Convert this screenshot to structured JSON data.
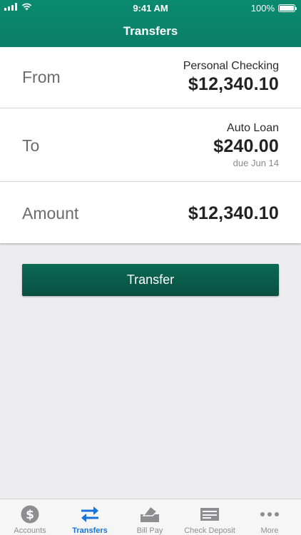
{
  "status": {
    "time": "9:41 AM",
    "battery": "100%",
    "battery_level": 1.0
  },
  "header": {
    "title": "Transfers"
  },
  "from": {
    "label": "From",
    "account": "Personal Checking",
    "amount": "$12,340.10"
  },
  "to": {
    "label": "To",
    "account": "Auto Loan",
    "amount": "$240.00",
    "due": "due Jun 14"
  },
  "amount_row": {
    "label": "Amount",
    "value": "$12,340.10"
  },
  "transfer_button": {
    "label": "Transfer"
  },
  "tabs": [
    {
      "label": "Accounts",
      "icon": "dollar-circle-icon"
    },
    {
      "label": "Transfers",
      "icon": "transfer-arrows-icon",
      "active": true
    },
    {
      "label": "Bill Pay",
      "icon": "bill-envelope-icon"
    },
    {
      "label": "Check Deposit",
      "icon": "check-icon"
    },
    {
      "label": "More",
      "icon": "more-dots-icon"
    }
  ],
  "colors": {
    "header": "#0b7f66",
    "button": "#0a5a49",
    "active_tab": "#1673d9",
    "inactive_tab": "#8e8e92"
  }
}
